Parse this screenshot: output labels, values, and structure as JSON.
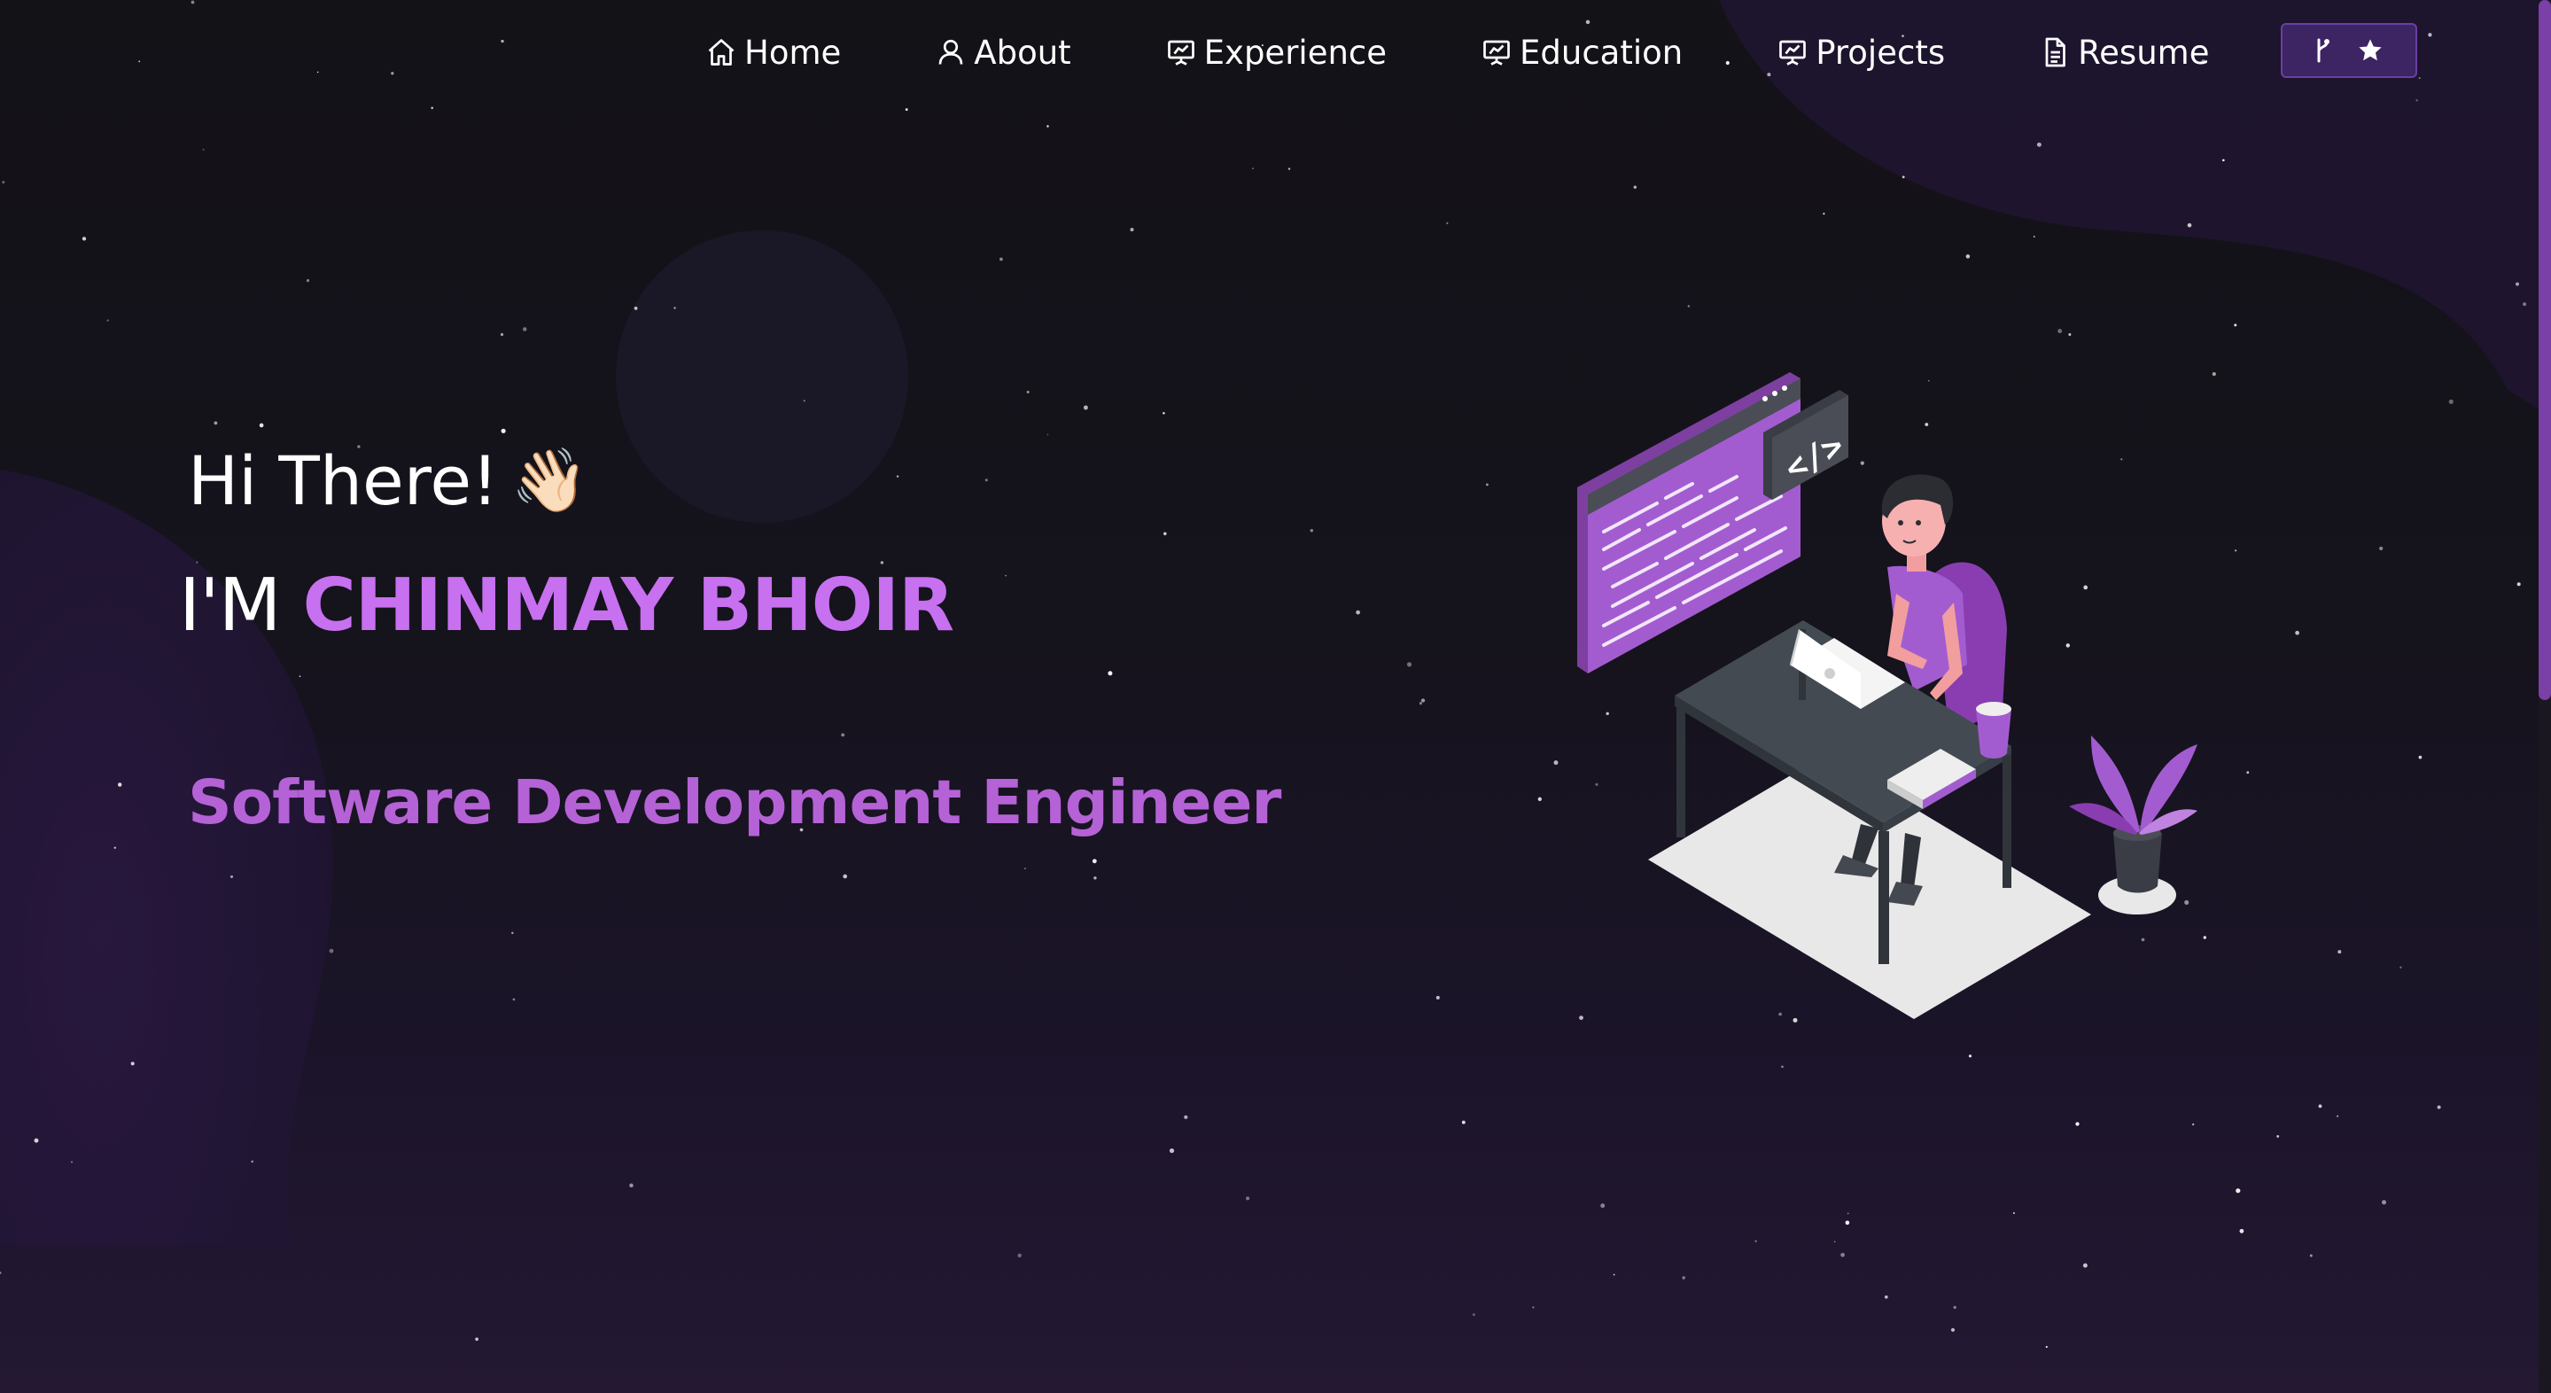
{
  "nav": {
    "items": [
      {
        "label": "Home",
        "icon": "home-icon"
      },
      {
        "label": "About",
        "icon": "user-icon"
      },
      {
        "label": "Experience",
        "icon": "presentation-chart-icon"
      },
      {
        "label": "Education",
        "icon": "presentation-chart-icon"
      },
      {
        "label": "Projects",
        "icon": "presentation-chart-icon"
      },
      {
        "label": "Resume",
        "icon": "document-icon"
      }
    ],
    "github_button": {
      "icons": [
        "fork-icon",
        "star-icon"
      ]
    }
  },
  "hero": {
    "greeting": "Hi There!",
    "wave_emoji": "👋🏻",
    "name_prefix": "I'M",
    "name": "CHINMAY BHOIR",
    "role": "Software Development Engineer"
  },
  "colors": {
    "background": "#141219",
    "accent": "#c770f0",
    "accent_dark": "#b562d6",
    "button_bg": "#3d2463"
  }
}
